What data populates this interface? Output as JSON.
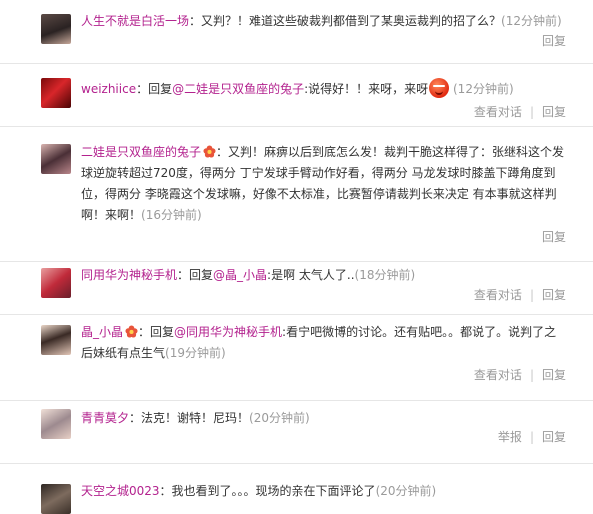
{
  "comments": [
    {
      "user": "人生不就是白活一场",
      "mention": "",
      "text": "：又判？！难道这些破裁判都借到了某奥运裁判的招了么？",
      "time": "(12分钟前)",
      "actions": [
        "回复"
      ]
    },
    {
      "user": "weizhiice",
      "prefix": "：回复",
      "mention": "@二娃是只双鱼座的兔子",
      "text": ":说得好！！来呀，来呀",
      "time": "(12分钟前)",
      "actions": [
        "查看对话",
        "回复"
      ]
    },
    {
      "user": "二娃是只双鱼座的兔子",
      "mention": "",
      "text": "：又判！麻痹以后到底怎么发！裁判干脆这样得了：张继科这个发球逆旋转超过720度，得两分 丁宁发球手臂动作好看，得两分 马龙发球时膝盖下蹲角度到位，得两分 李晓霞这个发球嘛，好像不太标准，比赛暂停请裁判长来决定 有本事就这样判啊！来啊！",
      "time": "(16分钟前)",
      "actions": [
        "回复"
      ]
    },
    {
      "user": "同用华为神秘手机",
      "prefix": "：回复",
      "mention": "@晶_小晶",
      "text": ":是啊 太气人了..",
      "time": "(18分钟前)",
      "actions": [
        "查看对话",
        "回复"
      ]
    },
    {
      "user": "晶_小晶",
      "prefix": "：回复",
      "mention": "@同用华为神秘手机",
      "text": ":看宁吧微博的讨论。还有贴吧。。都说了。说判了之后妹纸有点生气",
      "time": "(19分钟前)",
      "actions": [
        "查看对话",
        "回复"
      ]
    },
    {
      "user": "青青莫夕",
      "mention": "",
      "text": "：法克！谢特！尼玛！",
      "time": "(20分钟前)",
      "actions": [
        "举报",
        "回复"
      ]
    },
    {
      "user": "天空之城0023",
      "mention": "",
      "text": "：我也看到了。。。现场的亲在下面评论了",
      "time": "(20分钟前)",
      "actions": []
    }
  ],
  "icons": {
    "angry_emoji": "angry-face-emoji-icon",
    "member_badge": "flower-badge-icon"
  },
  "colors": {
    "username": "#b3228e",
    "meta": "#9a9a9a",
    "divider": "#e6e6e6"
  }
}
